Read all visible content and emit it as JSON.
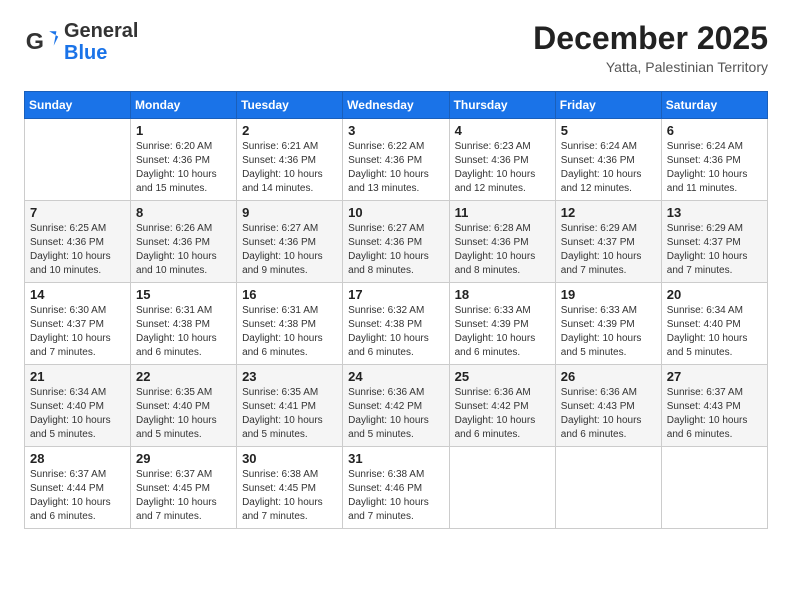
{
  "header": {
    "logo": {
      "general": "General",
      "blue": "Blue"
    },
    "title": "December 2025",
    "location": "Yatta, Palestinian Territory"
  },
  "days_of_week": [
    "Sunday",
    "Monday",
    "Tuesday",
    "Wednesday",
    "Thursday",
    "Friday",
    "Saturday"
  ],
  "weeks": [
    [
      {
        "day": "",
        "info": ""
      },
      {
        "day": "1",
        "info": "Sunrise: 6:20 AM\nSunset: 4:36 PM\nDaylight: 10 hours\nand 15 minutes."
      },
      {
        "day": "2",
        "info": "Sunrise: 6:21 AM\nSunset: 4:36 PM\nDaylight: 10 hours\nand 14 minutes."
      },
      {
        "day": "3",
        "info": "Sunrise: 6:22 AM\nSunset: 4:36 PM\nDaylight: 10 hours\nand 13 minutes."
      },
      {
        "day": "4",
        "info": "Sunrise: 6:23 AM\nSunset: 4:36 PM\nDaylight: 10 hours\nand 12 minutes."
      },
      {
        "day": "5",
        "info": "Sunrise: 6:24 AM\nSunset: 4:36 PM\nDaylight: 10 hours\nand 12 minutes."
      },
      {
        "day": "6",
        "info": "Sunrise: 6:24 AM\nSunset: 4:36 PM\nDaylight: 10 hours\nand 11 minutes."
      }
    ],
    [
      {
        "day": "7",
        "info": "Sunrise: 6:25 AM\nSunset: 4:36 PM\nDaylight: 10 hours\nand 10 minutes."
      },
      {
        "day": "8",
        "info": "Sunrise: 6:26 AM\nSunset: 4:36 PM\nDaylight: 10 hours\nand 10 minutes."
      },
      {
        "day": "9",
        "info": "Sunrise: 6:27 AM\nSunset: 4:36 PM\nDaylight: 10 hours\nand 9 minutes."
      },
      {
        "day": "10",
        "info": "Sunrise: 6:27 AM\nSunset: 4:36 PM\nDaylight: 10 hours\nand 8 minutes."
      },
      {
        "day": "11",
        "info": "Sunrise: 6:28 AM\nSunset: 4:36 PM\nDaylight: 10 hours\nand 8 minutes."
      },
      {
        "day": "12",
        "info": "Sunrise: 6:29 AM\nSunset: 4:37 PM\nDaylight: 10 hours\nand 7 minutes."
      },
      {
        "day": "13",
        "info": "Sunrise: 6:29 AM\nSunset: 4:37 PM\nDaylight: 10 hours\nand 7 minutes."
      }
    ],
    [
      {
        "day": "14",
        "info": "Sunrise: 6:30 AM\nSunset: 4:37 PM\nDaylight: 10 hours\nand 7 minutes."
      },
      {
        "day": "15",
        "info": "Sunrise: 6:31 AM\nSunset: 4:38 PM\nDaylight: 10 hours\nand 6 minutes."
      },
      {
        "day": "16",
        "info": "Sunrise: 6:31 AM\nSunset: 4:38 PM\nDaylight: 10 hours\nand 6 minutes."
      },
      {
        "day": "17",
        "info": "Sunrise: 6:32 AM\nSunset: 4:38 PM\nDaylight: 10 hours\nand 6 minutes."
      },
      {
        "day": "18",
        "info": "Sunrise: 6:33 AM\nSunset: 4:39 PM\nDaylight: 10 hours\nand 6 minutes."
      },
      {
        "day": "19",
        "info": "Sunrise: 6:33 AM\nSunset: 4:39 PM\nDaylight: 10 hours\nand 5 minutes."
      },
      {
        "day": "20",
        "info": "Sunrise: 6:34 AM\nSunset: 4:40 PM\nDaylight: 10 hours\nand 5 minutes."
      }
    ],
    [
      {
        "day": "21",
        "info": "Sunrise: 6:34 AM\nSunset: 4:40 PM\nDaylight: 10 hours\nand 5 minutes."
      },
      {
        "day": "22",
        "info": "Sunrise: 6:35 AM\nSunset: 4:40 PM\nDaylight: 10 hours\nand 5 minutes."
      },
      {
        "day": "23",
        "info": "Sunrise: 6:35 AM\nSunset: 4:41 PM\nDaylight: 10 hours\nand 5 minutes."
      },
      {
        "day": "24",
        "info": "Sunrise: 6:36 AM\nSunset: 4:42 PM\nDaylight: 10 hours\nand 5 minutes."
      },
      {
        "day": "25",
        "info": "Sunrise: 6:36 AM\nSunset: 4:42 PM\nDaylight: 10 hours\nand 6 minutes."
      },
      {
        "day": "26",
        "info": "Sunrise: 6:36 AM\nSunset: 4:43 PM\nDaylight: 10 hours\nand 6 minutes."
      },
      {
        "day": "27",
        "info": "Sunrise: 6:37 AM\nSunset: 4:43 PM\nDaylight: 10 hours\nand 6 minutes."
      }
    ],
    [
      {
        "day": "28",
        "info": "Sunrise: 6:37 AM\nSunset: 4:44 PM\nDaylight: 10 hours\nand 6 minutes."
      },
      {
        "day": "29",
        "info": "Sunrise: 6:37 AM\nSunset: 4:45 PM\nDaylight: 10 hours\nand 7 minutes."
      },
      {
        "day": "30",
        "info": "Sunrise: 6:38 AM\nSunset: 4:45 PM\nDaylight: 10 hours\nand 7 minutes."
      },
      {
        "day": "31",
        "info": "Sunrise: 6:38 AM\nSunset: 4:46 PM\nDaylight: 10 hours\nand 7 minutes."
      },
      {
        "day": "",
        "info": ""
      },
      {
        "day": "",
        "info": ""
      },
      {
        "day": "",
        "info": ""
      }
    ]
  ]
}
